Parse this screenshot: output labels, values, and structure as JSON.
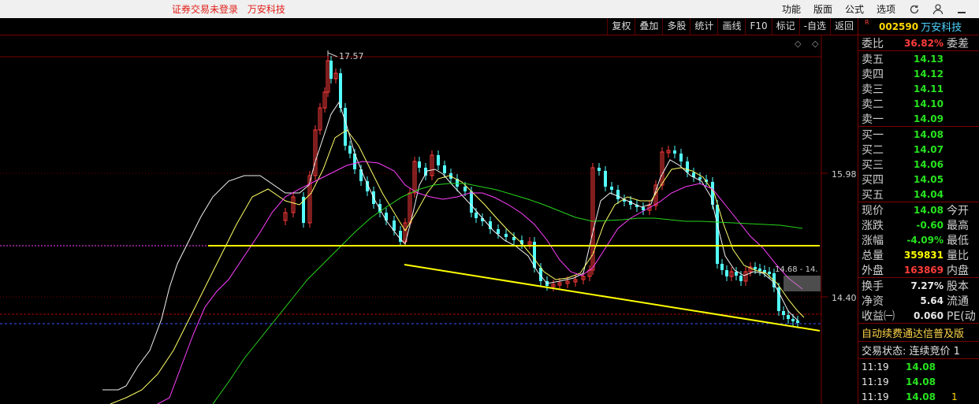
{
  "top_bar": {
    "status": [
      "证券交易未登录",
      "万安科技"
    ],
    "menu": [
      "功能",
      "版面",
      "公式",
      "选项"
    ],
    "icons": [
      "refresh-icon",
      "user-icon",
      "minimize-icon"
    ]
  },
  "toolbar": {
    "buttons": [
      "复权",
      "叠加",
      "多股",
      "统计",
      "画线",
      "F10",
      "标记",
      "-自选",
      "返回"
    ]
  },
  "chart": {
    "price_high_label": "17.57",
    "price_axis": [
      "15.98",
      "14.40"
    ],
    "range_label": "14.68 - 14.",
    "diamond_icon": "◇",
    "close_icon": "◇"
  },
  "stock": {
    "badge": "R",
    "code": "002590",
    "name": "万安科技"
  },
  "quote": {
    "weibi": {
      "label": "委比",
      "value": "36.82%",
      "label2": "委差"
    },
    "asks": [
      {
        "label": "卖五",
        "price": "14.13"
      },
      {
        "label": "卖四",
        "price": "14.12"
      },
      {
        "label": "卖三",
        "price": "14.11"
      },
      {
        "label": "卖二",
        "price": "14.10"
      },
      {
        "label": "卖一",
        "price": "14.09"
      }
    ],
    "bids": [
      {
        "label": "买一",
        "price": "14.08"
      },
      {
        "label": "买二",
        "price": "14.07"
      },
      {
        "label": "买三",
        "price": "14.06"
      },
      {
        "label": "买四",
        "price": "14.05"
      },
      {
        "label": "买五",
        "price": "14.04"
      }
    ],
    "stats1": [
      {
        "label": "现价",
        "value": "14.08",
        "label2": "今开"
      },
      {
        "label": "涨跌",
        "value": "-0.60",
        "label2": "最高"
      },
      {
        "label": "涨幅",
        "value": "-4.09%",
        "label2": "最低"
      },
      {
        "label": "总量",
        "value": "359831",
        "label2": "量比"
      },
      {
        "label": "外盘",
        "value": "163869",
        "label2": "内盘"
      }
    ],
    "stats2": [
      {
        "label": "换手",
        "value": "7.27%",
        "label2": "股本"
      },
      {
        "label": "净资",
        "value": "5.64",
        "label2": "流通"
      },
      {
        "label": "收益㈠",
        "value": "0.060",
        "label2": "PE(动"
      }
    ],
    "banner": "自动续费通达信普及版",
    "trade_status": "交易状态: 连续竞价 1",
    "ticks": [
      {
        "time": "11:19",
        "price": "14.08",
        "vol": ""
      },
      {
        "time": "11:19",
        "price": "14.08",
        "vol": ""
      },
      {
        "time": "11:19",
        "price": "14.08",
        "vol": "1"
      }
    ]
  },
  "colors": {
    "up": "#ff3b3b",
    "down": "#54ffff",
    "ma5": "#f2f2f2",
    "ma10": "#ffff66",
    "ma20": "#ff40ff",
    "ma60": "#27d41c",
    "trendline": "#ffff00",
    "grid": "#7a0000"
  }
}
